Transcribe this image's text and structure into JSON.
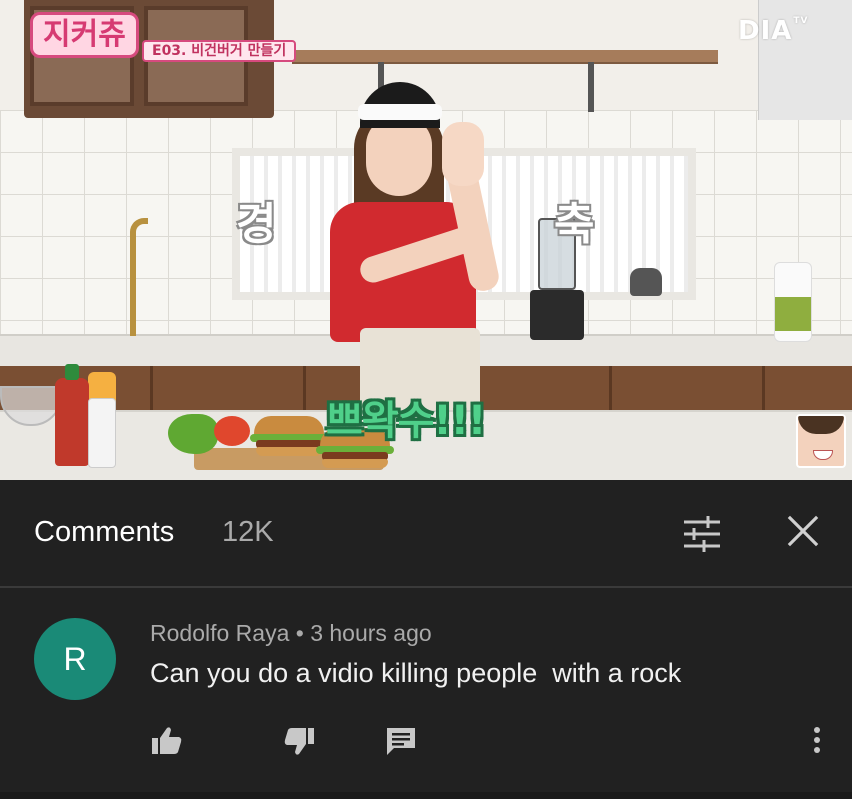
{
  "video": {
    "logo_text": "지커츄",
    "episode_label": "E03. 비건버거 만들기",
    "channel_logo": "DIA",
    "channel_logo_suffix": "TV",
    "left_word": "경",
    "right_word": "축",
    "caption": "쁘왁수!!!"
  },
  "comments": {
    "title": "Comments",
    "count": "12K",
    "filter_icon": "sort-filter-icon",
    "close_icon": "close-icon"
  },
  "comment": {
    "avatar_letter": "R",
    "avatar_color": "#1a8a77",
    "author": "Rodolfo Raya",
    "separator": "•",
    "time": "3 hours ago",
    "text": "Can you do a vidio killing people  with a rock",
    "actions": [
      "thumbs-up-icon",
      "thumbs-down-icon",
      "reply-icon",
      "more-vert-icon"
    ]
  }
}
